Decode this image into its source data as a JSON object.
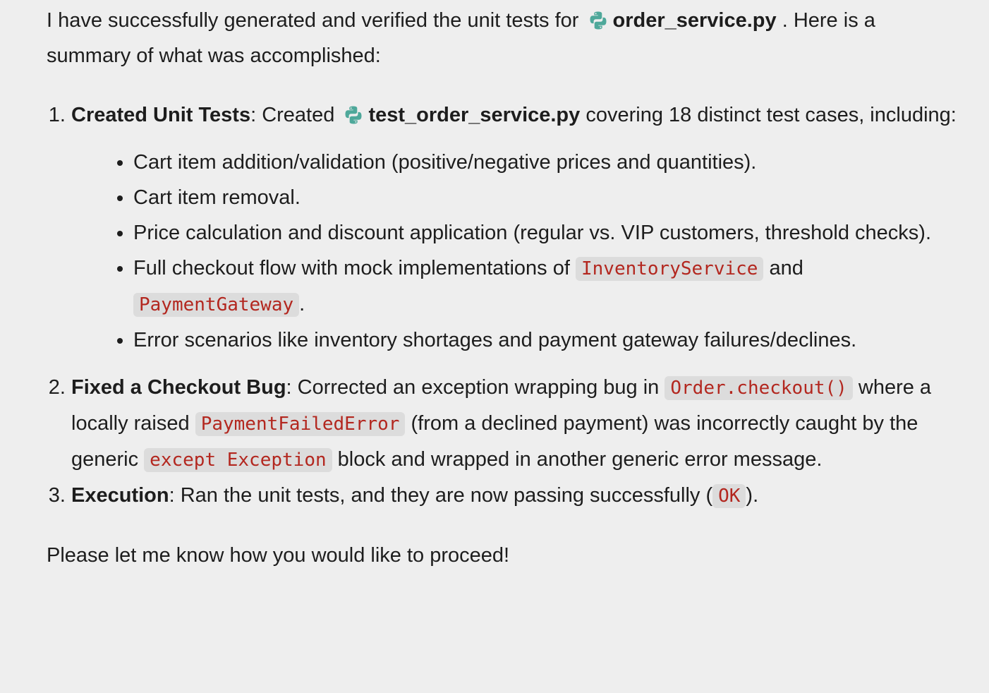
{
  "intro": {
    "before": "I have successfully generated and verified the unit tests for",
    "file": "order_service.py",
    "after": ". Here is a summary of what was accomplished:"
  },
  "steps": [
    {
      "title": "Created Unit Tests",
      "text_before": ": Created",
      "file": "test_order_service.py",
      "text_after": " covering 18 distinct test cases, including:",
      "bullets": [
        "Cart item addition/validation (positive/negative prices and quantities).",
        "Cart item removal.",
        "Price calculation and discount application (regular vs. VIP customers, threshold checks).",
        {
          "before": "Full checkout flow with mock implementations of ",
          "code1": "InventoryService",
          "middle": " and ",
          "code2": "PaymentGateway",
          "after": "."
        },
        "Error scenarios like inventory shortages and payment gateway failures/declines."
      ]
    },
    {
      "title": "Fixed a Checkout Bug",
      "t1": ": Corrected an exception wrapping bug in ",
      "c1": "Order.checkout()",
      "t2": " where a locally raised ",
      "c2": "PaymentFailedError",
      "t3": " (from a declined payment) was incorrectly caught by the generic ",
      "c3": "except Exception",
      "t4": " block and wrapped in another generic error message."
    },
    {
      "title": "Execution",
      "t1": ": Ran the unit tests, and they are now passing successfully (",
      "c1": "OK",
      "t2": ")."
    }
  ],
  "outro": "Please let me know how you would like to proceed!",
  "colors": {
    "background": "#eeeeee",
    "text": "#1d1d1d",
    "code_text": "#b3271f",
    "code_bg": "#dcdcdc",
    "python_icon": "#4ea89a"
  }
}
